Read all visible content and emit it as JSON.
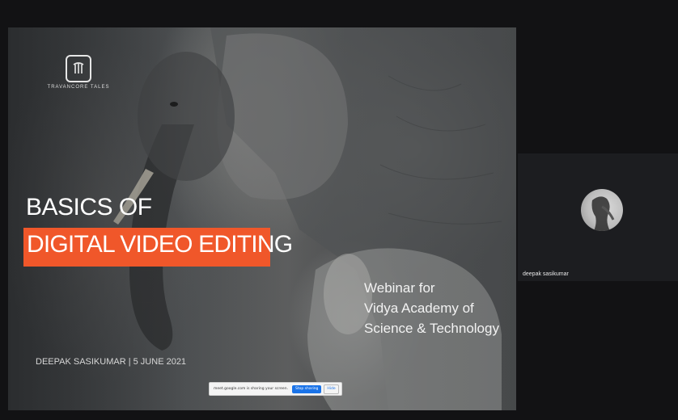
{
  "slide": {
    "logo_text": "TRAVANCORE TALES",
    "title_line1": "BASICS OF",
    "title_line2": "DIGITAL VIDEO EDITING",
    "webinar_lines": [
      "Webinar for",
      "Vidya Academy of",
      "Science & Technology"
    ],
    "speaker_line": "DEEPAK SASIKUMAR  |  5 JUNE 2021",
    "accent_color": "#f0572a"
  },
  "share_bar": {
    "message": "meet.google.com is sharing your screen.",
    "stop_label": "Stop sharing",
    "hide_label": "Hide"
  },
  "participant": {
    "name": "deepak sasikumar"
  }
}
